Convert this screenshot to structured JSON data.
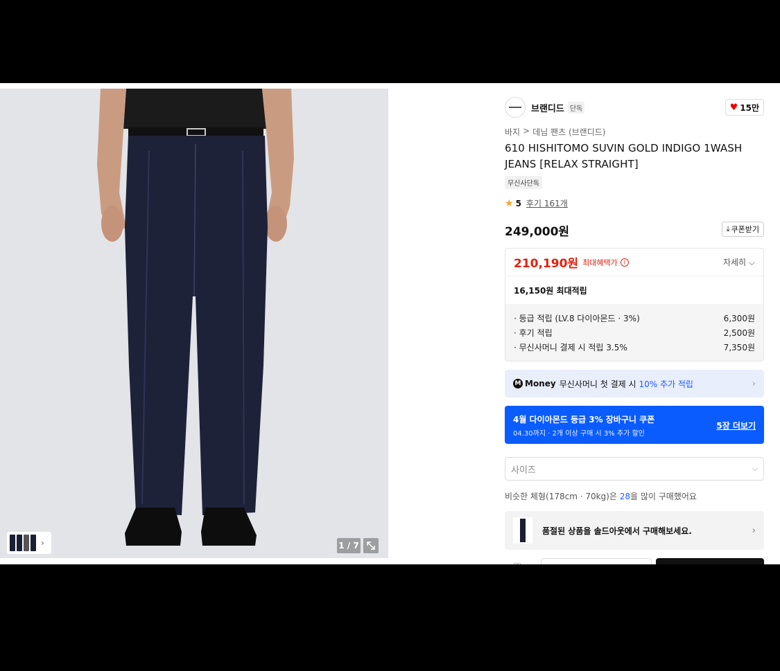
{
  "brand": {
    "name": "브랜디드",
    "tag": "단독",
    "likes": "15만",
    "like_icon": "heart-icon"
  },
  "breadcrumb": [
    "바지",
    ">",
    "데님 팬츠 (브랜디드)"
  ],
  "product": {
    "title": "610 HISHITOMO SUVIN GOLD INDIGO 1WASH JEANS [RELAX STRAIGHT]",
    "exclusive_badge": "무신사단독",
    "rating": "5",
    "review_label": "후기 161개",
    "price": "249,000원"
  },
  "coupon_button": "쿠폰받기",
  "benefit": {
    "sale_price": "210,190원",
    "sale_label": "최대혜택가",
    "detail_link": "자세히",
    "points_total": "16,150원 최대적립",
    "points": [
      {
        "label": "· 등급 적립 (LV.8 다이아몬드 · 3%)",
        "value": "6,300원"
      },
      {
        "label": "· 후기 적립",
        "value": "2,500원"
      },
      {
        "label": "· 무신사머니 결제 시 적립 3.5%",
        "value": "7,350원"
      }
    ]
  },
  "money_banner": {
    "logo": "M",
    "brand": "Money",
    "text": "무신사머니 첫 결제 시",
    "highlight": "10% 추가 적립"
  },
  "promo_banner": {
    "title": "4월 다이아몬드 등급 3% 장바구니 쿠폰",
    "subtitle": "04.30까지 · 2개 이상 구매 시 3% 추가 할인",
    "more": "5장 더보기",
    "color": "#0a5cff"
  },
  "size_select": {
    "placeholder": "사이즈"
  },
  "similar": {
    "prefix": "비슷한 체형(178cm · 70kg)은",
    "num": "28",
    "suffix": "을 많이 구매했어요"
  },
  "soldout": {
    "text": "품절된 상품을 솔드아웃에서 구매해보세요."
  },
  "gallery": {
    "counter": "1 / 7"
  },
  "colors": {
    "sale_red": "#e3200f",
    "accent_blue": "#1f5bff"
  }
}
